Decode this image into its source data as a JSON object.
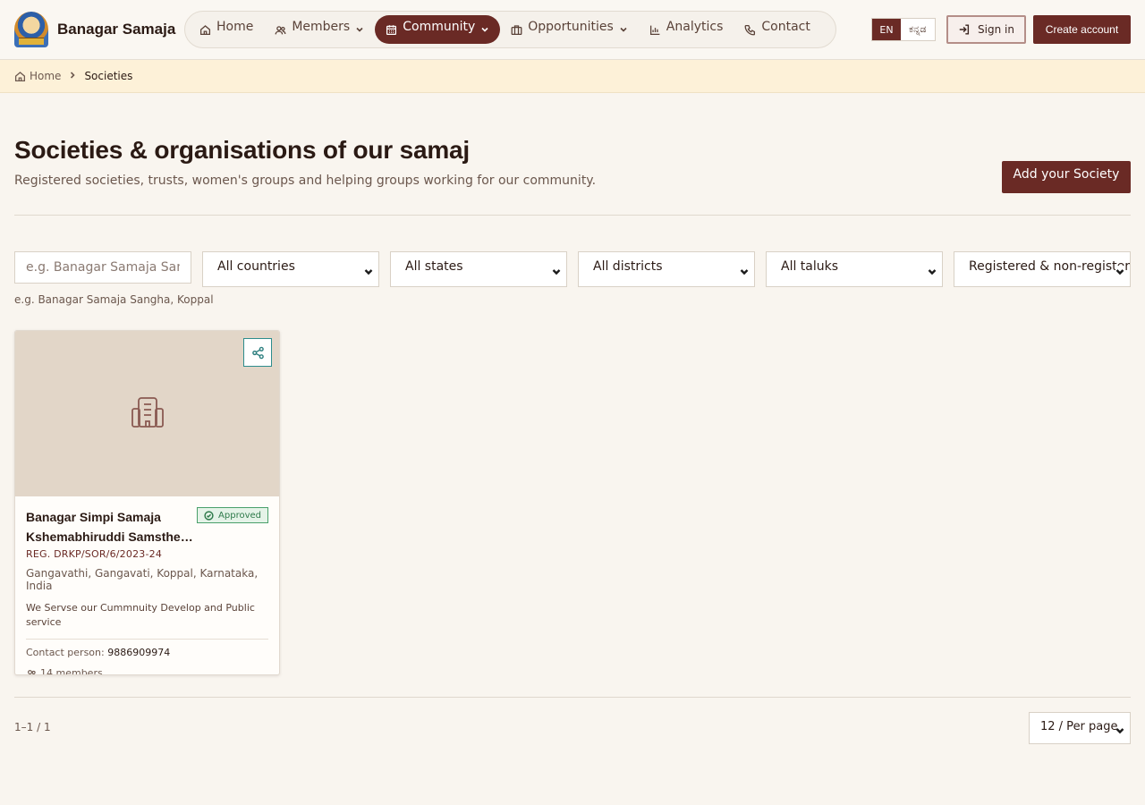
{
  "brand": {
    "name": "Banagar Samaja"
  },
  "nav": {
    "items": [
      {
        "label": "Home",
        "icon": "home-icon"
      },
      {
        "label": "Members",
        "icon": "users-icon",
        "dropdown": true
      },
      {
        "label": "Community",
        "icon": "calendar-icon",
        "dropdown": true,
        "active": true
      },
      {
        "label": "Opportunities",
        "icon": "briefcase-icon",
        "dropdown": true
      },
      {
        "label": "Analytics",
        "icon": "bar-chart-icon"
      },
      {
        "label": "Contact",
        "icon": "phone-icon"
      }
    ]
  },
  "lang": {
    "en": "EN",
    "kn": "ಕನ್ನಡ",
    "active": "EN"
  },
  "auth": {
    "signin": "Sign in",
    "create": "Create account"
  },
  "breadcrumb": {
    "home": "Home",
    "current": "Societies"
  },
  "page": {
    "title": "Societies & organisations of our samaj",
    "subtitle": "Registered societies, trusts, women's groups and helping groups working for our community.",
    "add_button": "Add your Society"
  },
  "filters": {
    "search_placeholder": "e.g. Banagar Samaja Sangha, Koppal",
    "country": "All countries",
    "state": "All states",
    "district": "All districts",
    "taluk": "All taluks",
    "registration": "Registered & non-registered",
    "hint": "e.g. Banagar Samaja Sangha, Koppal"
  },
  "societies": [
    {
      "name": "Banagar Simpi Samaja Kshemabhiruddi Samsthe…",
      "status": "Approved",
      "reg": "REG. DRKP/SOR/6/2023-24",
      "location": "Gangavathi, Gangavati, Koppal, Karnataka, India",
      "description": "We Servse our Cummnuity Develop and Public service",
      "contact_label": "Contact person:",
      "contact_phone": "9886909974",
      "members": "14 members"
    }
  ],
  "pagination": {
    "range": "1–1 / 1",
    "per_page": "12 / Per page"
  },
  "colors": {
    "accent": "#6a2a25",
    "background": "#f9f5ef",
    "breadcrumb_bg": "#fdf1d8",
    "approved": "#2e7a4a"
  }
}
